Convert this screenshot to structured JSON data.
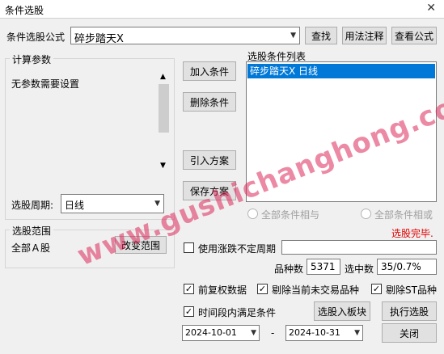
{
  "window": {
    "title": "条件选股",
    "close_label": "✕"
  },
  "formula": {
    "label": "条件选股公式",
    "value": "碎步踏天X",
    "find_label": "查找",
    "usage_label": "用法注释",
    "view_label": "查看公式"
  },
  "params": {
    "legend": "计算参数",
    "text": "无参数需要设置",
    "period_label": "选股周期:",
    "period_value": "日线"
  },
  "actions": {
    "add": "加入条件",
    "remove": "删除条件",
    "import": "引入方案",
    "save": "保存方案"
  },
  "conditions": {
    "label": "选股条件列表",
    "items": [
      "碎步踏天X  日线"
    ]
  },
  "logic": {
    "and_label": "全部条件相与",
    "or_label": "全部条件相或"
  },
  "scope": {
    "legend": "选股范围",
    "value": "全部Ａ股",
    "change_label": "改变范围"
  },
  "status": {
    "text": "选股完毕."
  },
  "options": {
    "limit_label": "使用涨跌不定周期",
    "count_label": "品种数",
    "count_value": "5371",
    "hit_label": "选中数",
    "hit_value": "35/0.7%",
    "adjusted_label": "前复权数据",
    "remove_untraded_label": "剔除当前未交易品种",
    "remove_st_label": "剔除ST品种",
    "period_cond_label": "时间段内满足条件"
  },
  "dates": {
    "start": "2024-10-01",
    "sep": "-",
    "end": "2024-10-31"
  },
  "buttons": {
    "to_block": "选股入板块",
    "execute": "执行选股",
    "close": "关闭"
  },
  "watermark": "www.gushichanghong.com",
  "colors": {
    "status_red": "#e00000",
    "selection_blue": "#0078d7"
  }
}
